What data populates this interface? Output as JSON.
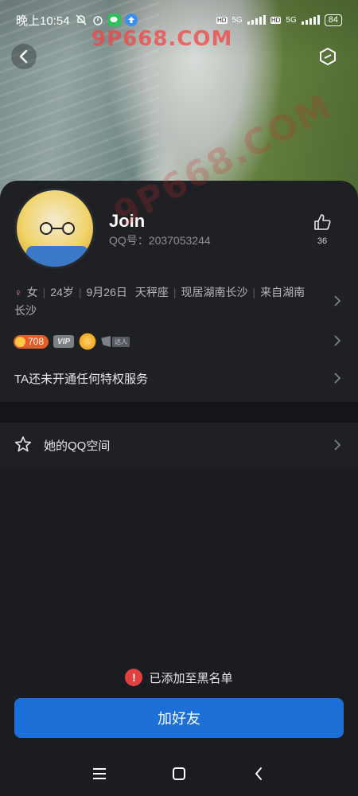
{
  "status_bar": {
    "time": "晚上10:54",
    "signal_label_1": "5G",
    "signal_label_2": "5G",
    "hd_label_1": "HD",
    "hd_label_2": "HD",
    "battery": "84"
  },
  "watermark": {
    "top": "9P668.COM",
    "diagonal": "9P668.COM"
  },
  "profile": {
    "nickname": "Join",
    "qq_label": "QQ号：",
    "qq_number": "2037053244",
    "likes": "36",
    "gender_symbol": "♀",
    "info": {
      "gender": "女",
      "age": "24岁",
      "birthday": "9月26日",
      "zodiac": "天秤座",
      "location": "现居湖南长沙",
      "hometown": "来自湖南长沙"
    },
    "badges": {
      "level": "708",
      "vip": "VIP",
      "wing_text": "达人"
    },
    "privilege_text": "TA还未开通任何特权服务"
  },
  "zone": {
    "label": "她的QQ空间"
  },
  "notice": {
    "icon": "!",
    "text": "已添加至黑名单"
  },
  "actions": {
    "add_friend": "加好友"
  },
  "colors": {
    "background": "#1b1c20",
    "card": "#1f2024",
    "accent": "#1b6fd6",
    "warning": "#e0413e",
    "level_badge": "#e55e2a"
  }
}
